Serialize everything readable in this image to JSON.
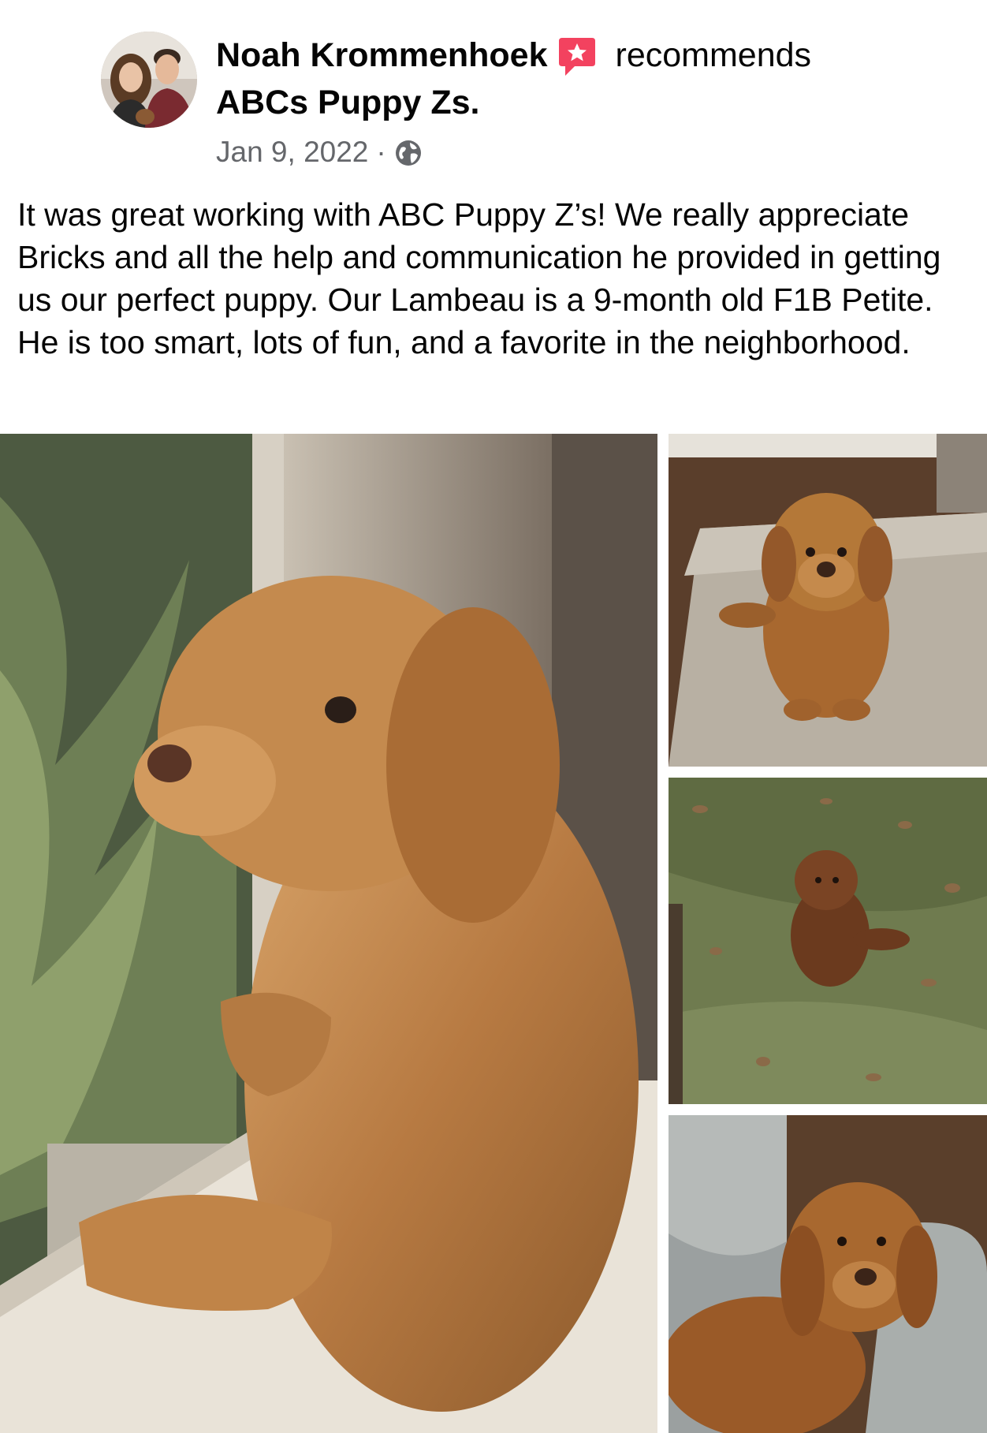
{
  "post": {
    "author": "Noah Krommenhoek",
    "action": "recommends",
    "page_name": "ABCs Puppy Zs.",
    "date": "Jan 9, 2022",
    "separator": "·",
    "privacy_icon": "globe-icon",
    "recommend_icon": "recommend-star-icon",
    "body": "It was great working with ABC Puppy Z’s! We really appreciate Bricks and all the help and communication he provided in getting us our perfect puppy. Our Lambeau is a 9-month old F1B Petite. He is too smart, lots of fun, and a favorite in the neighborhood."
  },
  "colors": {
    "text": "#050505",
    "secondary_text": "#65676b",
    "recommend_red": "#f3425f",
    "background": "#ffffff"
  }
}
